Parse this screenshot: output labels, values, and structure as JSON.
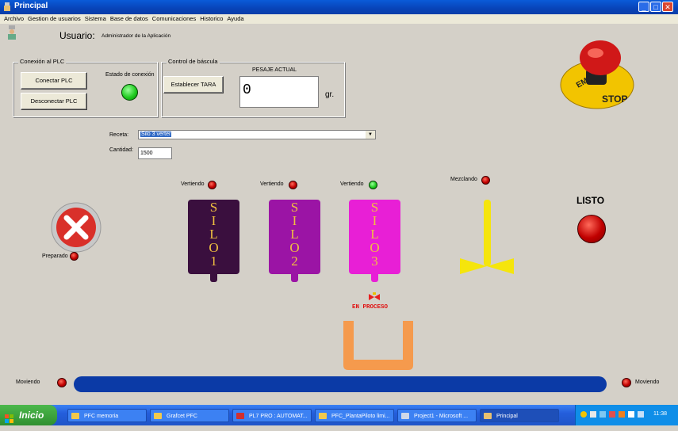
{
  "window": {
    "title": "Principal"
  },
  "menu": [
    "Archivo",
    "Gestion de usuarios",
    "Sistema",
    "Base de datos",
    "Comunicaciones",
    "Historico",
    "Ayuda"
  ],
  "user": {
    "label": "Usuario:",
    "value": "Administrador de la Aplicación"
  },
  "plc": {
    "legend": "Conexión al PLC",
    "connect": "Conectar PLC",
    "disconnect": "Desconectar PLC",
    "status_label": "Estado de conexión"
  },
  "scale": {
    "legend": "Control de báscula",
    "tare_button": "Establecer TARA",
    "weight_label": "PESAJE ACTUAL",
    "weight_value": "0",
    "unit": "gr."
  },
  "recipe": {
    "label": "Receta:",
    "value": "Silo 3 verter"
  },
  "quantity": {
    "label": "Cantidad:",
    "value": "1500"
  },
  "silos": [
    {
      "status": "Vertiendo",
      "letters": [
        "S",
        "I",
        "L",
        "O",
        "1"
      ],
      "color": "#3a0f3e"
    },
    {
      "status": "Vertiendo",
      "letters": [
        "S",
        "I",
        "L",
        "O",
        "2"
      ],
      "color": "#9b14a5"
    },
    {
      "status": "Vertiendo",
      "letters": [
        "S",
        "I",
        "L",
        "O",
        "3"
      ],
      "color": "#e81fd6"
    }
  ],
  "mixer": {
    "status": "Mezclando"
  },
  "ready": {
    "label": "LISTO"
  },
  "prepared": {
    "label": "Preparado"
  },
  "process": {
    "label": "EN PROCESO"
  },
  "conveyor": {
    "left_label": "Moviendo",
    "right_label": "Moviendo"
  },
  "emergency": {
    "text": "EMERGENCY STOP"
  },
  "taskbar": {
    "start": "Inicio",
    "items": [
      "PFC memoria",
      "Grafcet PFC",
      "PL7 PRO : AUTOMAT...",
      "PFC_PlantaPiloto limi...",
      "Project1 - Microsoft ...",
      "Principal"
    ],
    "clock": "11:38"
  },
  "colors": {
    "silo1": "#3a0f3e",
    "silo2": "#9b14a5",
    "silo3": "#e81fd6",
    "mixer": "#f5e50c",
    "hopper": "#f59a4d",
    "conveyor": "#0b3aa6"
  }
}
